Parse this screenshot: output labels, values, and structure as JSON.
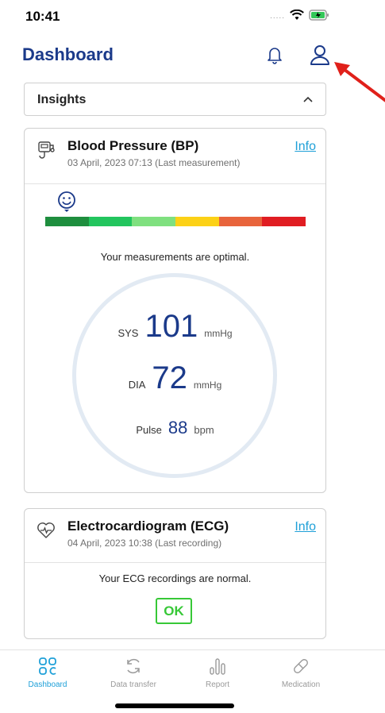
{
  "status_bar": {
    "time": "10:41",
    "signal": "....."
  },
  "header": {
    "title": "Dashboard"
  },
  "insights": {
    "label": "Insights"
  },
  "bp_card": {
    "title": "Blood Pressure (BP)",
    "subtitle": "03 April, 2023 07:13 (Last measurement)",
    "info_label": "Info",
    "status_text": "Your measurements are optimal.",
    "scale_colors": [
      "#1e8e3e",
      "#22c55e",
      "#7fe07f",
      "#fcd116",
      "#e8643c",
      "#e01d22"
    ],
    "sys": {
      "label": "SYS",
      "value": "101",
      "unit": "mmHg"
    },
    "dia": {
      "label": "DIA",
      "value": "72",
      "unit": "mmHg"
    },
    "pulse": {
      "label": "Pulse",
      "value": "88",
      "unit": "bpm"
    }
  },
  "ecg_card": {
    "title": "Electrocardiogram (ECG)",
    "subtitle": "04 April, 2023 10:38 (Last recording)",
    "info_label": "Info",
    "status_text": "Your ECG recordings are normal.",
    "badge": "OK"
  },
  "tab_bar": {
    "tabs": [
      {
        "label": "Dashboard",
        "icon": "dashboard-grid-icon",
        "active": true
      },
      {
        "label": "Data transfer",
        "icon": "sync-icon",
        "active": false
      },
      {
        "label": "Report",
        "icon": "report-bars-icon",
        "active": false
      },
      {
        "label": "Medication",
        "icon": "pill-icon",
        "active": false
      }
    ]
  },
  "colors": {
    "brand_navy": "#1b3a8a",
    "link_blue": "#1fa0d8",
    "ok_green": "#37c837",
    "annotation_red": "#e0201a"
  }
}
